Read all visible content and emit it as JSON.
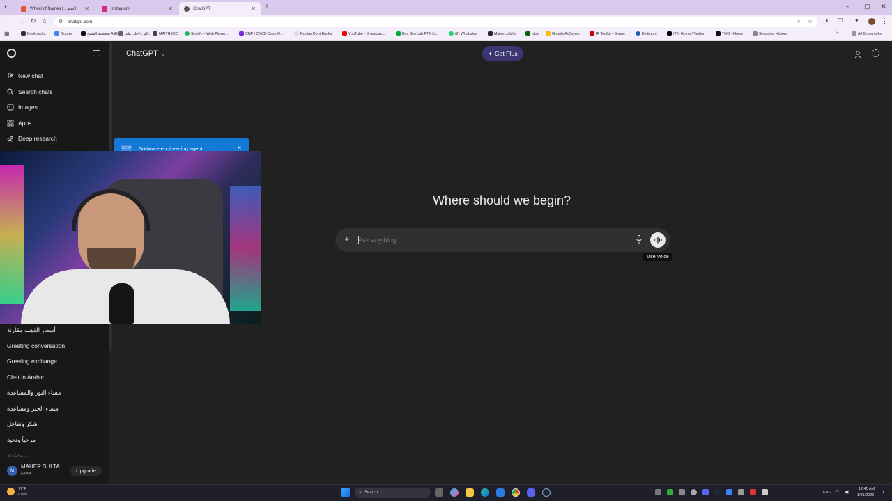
{
  "browser": {
    "tabs": [
      {
        "title": "Wheel of Names | ...نسل الأسم",
        "active": false
      },
      {
        "title": "Instagram",
        "active": false
      },
      {
        "title": "ChatGPT",
        "active": true
      }
    ],
    "url": "chatgpt.com",
    "bookmarks": [
      "Bookmarks",
      "Google",
      "شخصية المسح AliBb",
      "ركول | جلي هانز",
      "MAITHECO",
      "Spotify – Web Player:...",
      "CNP | CNCD Case O...",
      "Ronins Dont Books",
      "YouTube - Broadcas...",
      "Buy Sim Lab PTX Li...",
      "(2) WhatsApp",
      "Mahercodphs",
      "Idols",
      "Google AdSense",
      "IR Toolkit • Somer",
      "Bedroom",
      "(76) Home / Twitter",
      "TOO - Home",
      "Shopping History"
    ],
    "all_bookmarks": "All Bookmarks"
  },
  "sidebar": {
    "items": [
      {
        "label": "New chat",
        "icon": "new-chat-icon"
      },
      {
        "label": "Search chats",
        "icon": "search-icon"
      },
      {
        "label": "Images",
        "icon": "images-icon"
      },
      {
        "label": "Apps",
        "icon": "apps-icon"
      },
      {
        "label": "Deep research",
        "icon": "telescope-icon"
      }
    ],
    "chats": [
      "أسعار الذهب مقارنة",
      "Greeting conversation",
      "Greeting exchange",
      "Chat in Arabic",
      "مساء النور والمساعدة",
      "مساء الخير ومساعدة",
      "شكر وتفاعل",
      "مرحباً وتحية",
      "محادثة..."
    ],
    "user": {
      "name": "MAHER SULTA...",
      "plan": "Free",
      "initials": "M"
    },
    "upgrade_label": "Upgrade"
  },
  "promo": {
    "badge": "NEW",
    "text": "Software engineering agent"
  },
  "header": {
    "model": "ChatGPT",
    "get_plus": "Get Plus"
  },
  "main": {
    "title": "Where should we begin?",
    "placeholder": "Ask anything",
    "tooltip": "Use Voice"
  },
  "taskbar": {
    "weather_temp": "77°F",
    "weather_desc": "Clear",
    "search_placeholder": "Search",
    "lang": "ENG",
    "time": "12:45 AM",
    "date": "1/31/2026"
  }
}
